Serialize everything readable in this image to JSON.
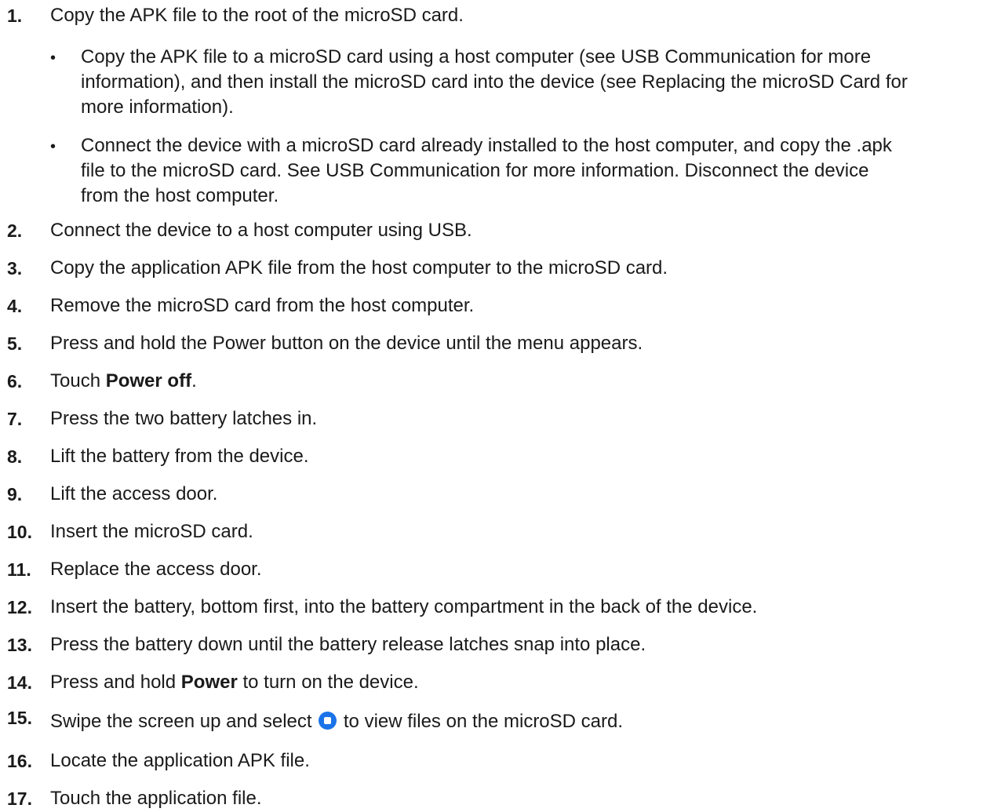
{
  "steps": [
    {
      "num": "1.",
      "text": "Copy the APK file to the root of the microSD card."
    },
    {
      "num": "2.",
      "text": "Connect the device to a host computer using USB."
    },
    {
      "num": "3.",
      "text": "Copy the application APK file from the host computer to the microSD card."
    },
    {
      "num": "4.",
      "text": "Remove the microSD card from the host computer."
    },
    {
      "num": "5.",
      "text": "Press and hold the Power button on the device until the menu appears."
    },
    {
      "num": "6.",
      "pre": "Touch ",
      "bold": "Power off",
      "post": "."
    },
    {
      "num": "7.",
      "text": "Press the two battery latches in."
    },
    {
      "num": "8.",
      "text": "Lift the battery from the device."
    },
    {
      "num": "9.",
      "text": "Lift the access door."
    },
    {
      "num": "10.",
      "text": "Insert the microSD card."
    },
    {
      "num": "11.",
      "text": "Replace the access door."
    },
    {
      "num": "12.",
      "text": "Insert the battery, bottom first, into the battery compartment in the back of the device."
    },
    {
      "num": "13.",
      "text": "Press the battery down until the battery release latches snap into place."
    },
    {
      "num": "14.",
      "pre": "Press and hold ",
      "bold": "Power",
      "post": " to turn on the device."
    },
    {
      "num": "15.",
      "pre": "Swipe the screen up and select ",
      "post": " to view files on the microSD card.",
      "icon": "files-app-icon"
    },
    {
      "num": "16.",
      "text": "Locate the application APK file."
    },
    {
      "num": "17.",
      "text": "Touch the application file."
    }
  ],
  "substeps": [
    {
      "bullet": "•",
      "lines": [
        "Copy the APK file to a microSD card using a host computer (see USB Communication for more",
        "information), and then install the microSD card into the device (see Replacing the microSD Card for",
        "more information)."
      ]
    },
    {
      "bullet": "•",
      "lines": [
        "Connect the device with a microSD card already installed to the host computer, and copy the .apk",
        "file to the microSD card. See USB Communication for more information. Disconnect the device",
        "from the host computer."
      ]
    }
  ],
  "colors": {
    "text": "#1a1a1a",
    "icon": "#1a73e8"
  }
}
